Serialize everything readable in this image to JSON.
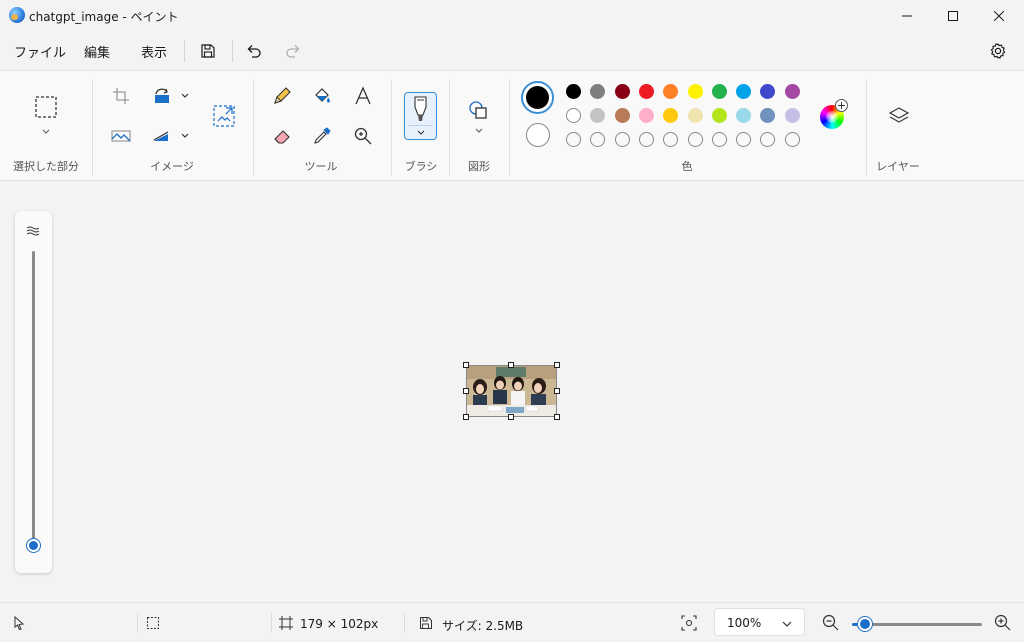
{
  "window": {
    "title": "chatgpt_image - ペイント"
  },
  "menu": {
    "file": "ファイル",
    "edit": "編集",
    "view": "表示"
  },
  "ribbon": {
    "groups": {
      "selection": "選択した部分",
      "image": "イメージ",
      "tools": "ツール",
      "brush": "ブラシ",
      "shapes": "図形",
      "colors": "色",
      "layers": "レイヤー"
    },
    "primary_color": "#000000",
    "secondary_color": "#ffffff",
    "palette_row1": [
      "#000000",
      "#7f7f7f",
      "#880015",
      "#ed1c24",
      "#ff7f27",
      "#fff200",
      "#22b14c",
      "#00a2e8",
      "#3f48cc",
      "#a349a4"
    ],
    "palette_row2": [
      "#ffffff",
      "#c3c3c3",
      "#b97a57",
      "#ffaec9",
      "#ffc90e",
      "#efe4b0",
      "#b5e61d",
      "#99d9ea",
      "#7092be",
      "#c8bfe7"
    ]
  },
  "status": {
    "canvas_size": "179 × 102px",
    "file_size": "サイズ: 2.5MB",
    "zoom": "100%"
  }
}
